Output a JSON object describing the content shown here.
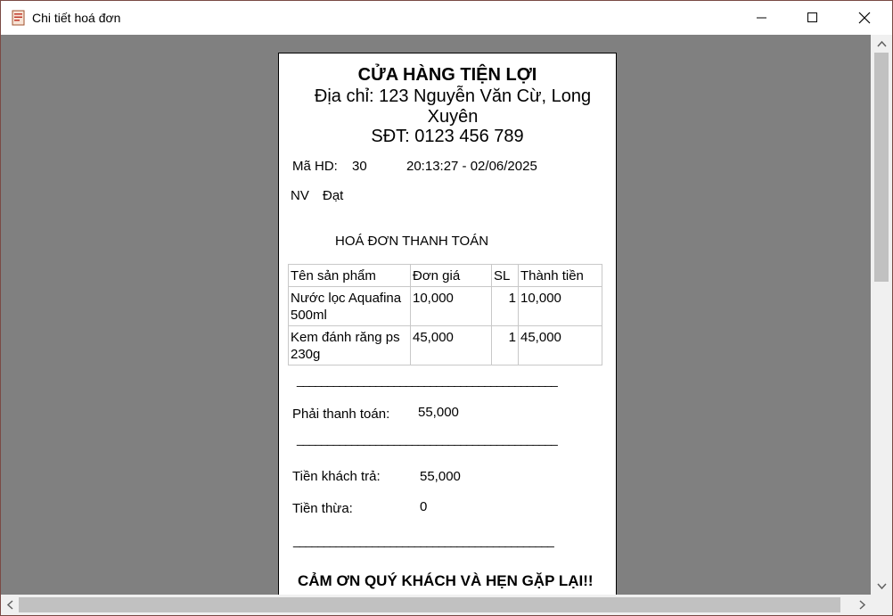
{
  "window": {
    "title": "Chi tiết hoá đơn"
  },
  "receipt": {
    "shop_name": "CỬA HÀNG TIỆN LỢI",
    "address": "Địa chỉ: 123 Nguyễn Văn Cừ, Long Xuyên",
    "phone": "SĐT: 0123 456 789",
    "invoice_label": "Mã HD:",
    "invoice_no": "30",
    "datetime": "20:13:27 - 02/06/2025",
    "staff_label": "NV",
    "staff_name": "Đạt",
    "heading": "HOÁ ĐƠN THANH TOÁN",
    "columns": [
      "Tên sản phẩm",
      "Đơn giá",
      "SL",
      "Thành tiền"
    ],
    "items": [
      {
        "name": "Nước lọc Aquafina 500ml",
        "price": "10,000",
        "qty": "1",
        "total": "10,000"
      },
      {
        "name": "Kem đánh răng ps 230g",
        "price": "45,000",
        "qty": "1",
        "total": "45,000"
      }
    ],
    "divider": "___________________________________________",
    "total_label": "Phải thanh toán:",
    "total_value": "55,000",
    "paid_label": "Tiền khách trả:",
    "paid_value": "55,000",
    "change_label": "Tiền thừa:",
    "change_value": "0",
    "thanks": "CẢM ƠN QUÝ KHÁCH VÀ HẸN GẶP LẠI!!"
  },
  "icons": {
    "app": "receipt-icon",
    "minimize": "minimize-icon",
    "maximize": "maximize-icon",
    "close": "close-icon"
  },
  "colors": {
    "background": "#808080",
    "paper": "#ffffff",
    "scrollbar": "#f0f0f0"
  }
}
